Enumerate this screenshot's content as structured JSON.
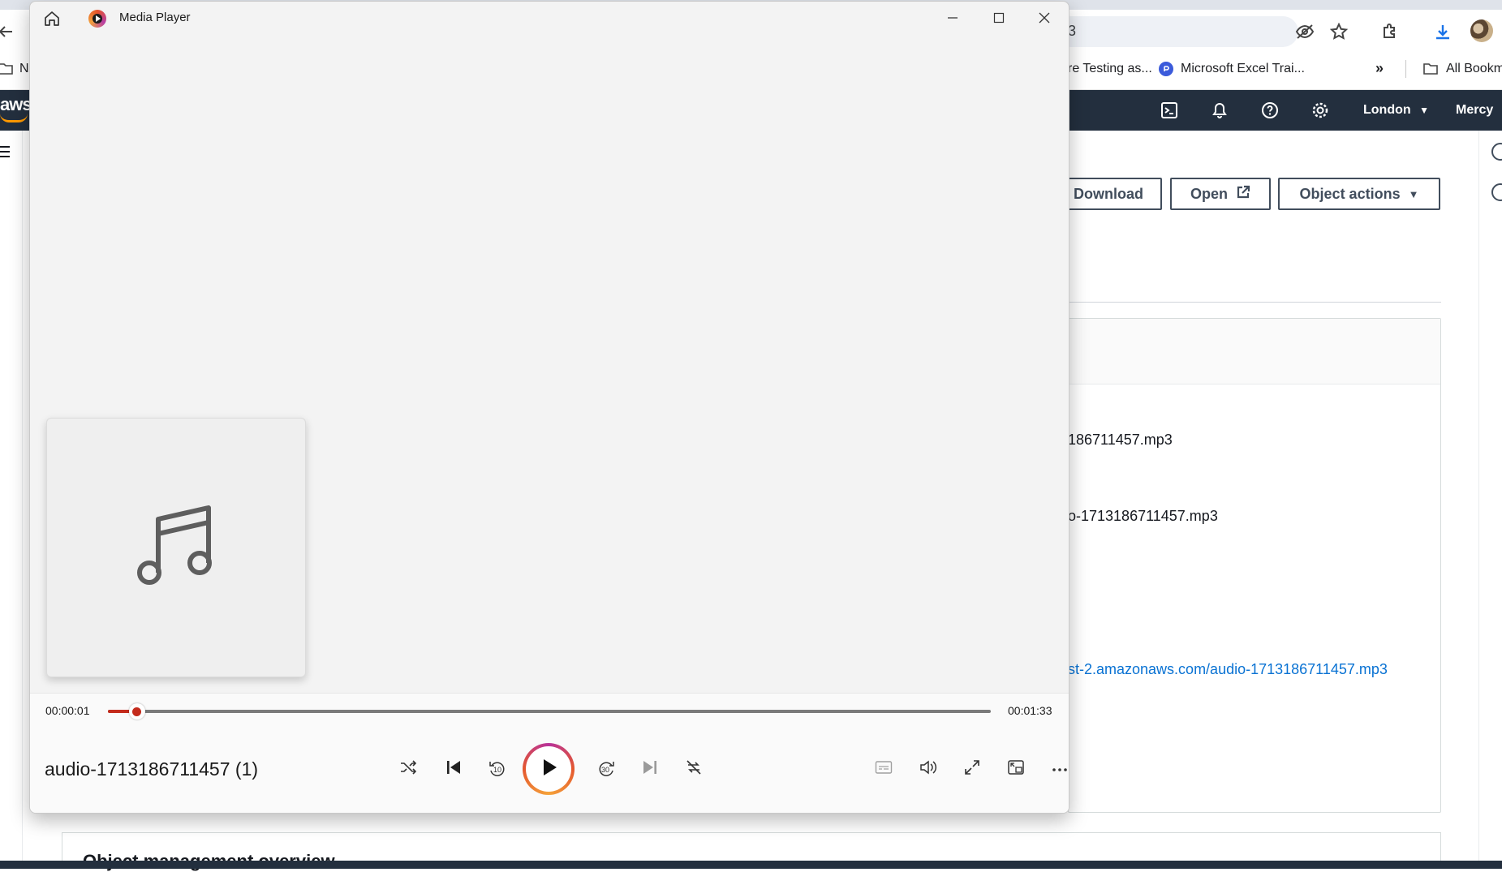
{
  "browser": {
    "address_fragment": "3",
    "bookmarks": [
      {
        "label": "N"
      },
      {
        "label": "re Testing as..."
      },
      {
        "label": "Microsoft Excel Trai..."
      },
      {
        "label": "All Bookm"
      }
    ]
  },
  "aws": {
    "logo": "aws",
    "region": "London",
    "user": "Mercy",
    "buttons": {
      "download": "Download",
      "open": "Open",
      "object_actions": "Object actions"
    },
    "details": {
      "key_fragment": "186711457.mp3",
      "name_fragment": "o-1713186711457.mp3",
      "url_fragment": "st-2.amazonaws.com/audio-1713186711457.mp3"
    },
    "section_title": "Object management overview"
  },
  "player": {
    "app_title": "Media Player",
    "current_time": "00:00:01",
    "total_time": "00:01:33",
    "progress_fraction": 0.011,
    "track_name": "audio-1713186711457 (1)",
    "skip_back_seconds": "10",
    "skip_forward_seconds": "30",
    "accent_color": "#c42b1c"
  }
}
